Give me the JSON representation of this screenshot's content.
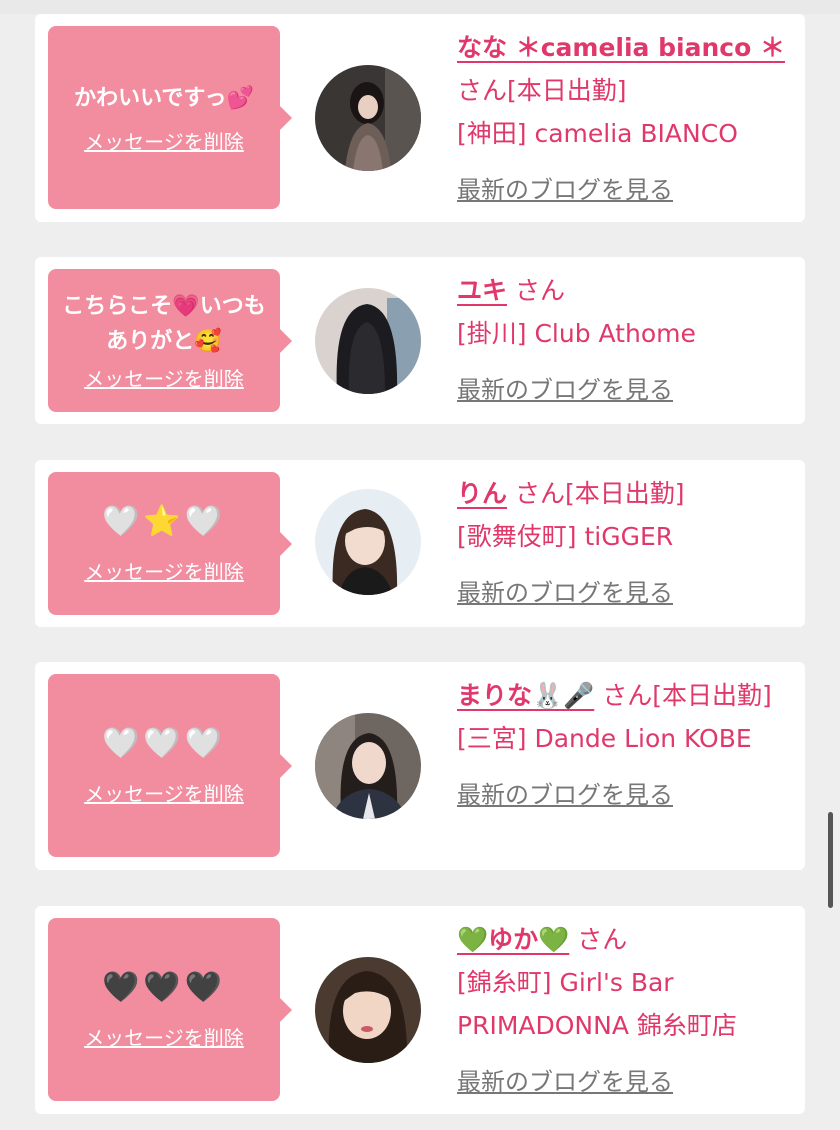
{
  "common": {
    "delete_label": "メッセージを削除",
    "blog_label": "最新のブログを見る"
  },
  "cards": [
    {
      "message": "かわいいですっ💕",
      "name": "なな ＊camelia bianco ＊",
      "status": "さん[本日出勤]",
      "shop": "[神田] camelia BIANCO"
    },
    {
      "message": "こちらこそ💗いつもありがと🥰",
      "name": "ユキ",
      "status": "さん",
      "shop": "[掛川] Club Athome"
    },
    {
      "message": "🤍⭐🤍",
      "name": "りん",
      "status": "さん[本日出勤]",
      "shop": "[歌舞伎町] tiGGER"
    },
    {
      "message": "🤍🤍🤍",
      "name": "まりな🐰🎤",
      "status": "さん[本日出勤]",
      "shop": "[三宮] Dande Lion KOBE"
    },
    {
      "message": "🖤🖤🖤",
      "name": "💚ゆか💚",
      "status": "さん",
      "shop": "[錦糸町] Girl's Bar PRIMADONNA 錦糸町店"
    }
  ],
  "colors": {
    "accent_pink": "#e0386a",
    "bubble_pink": "#f28da0",
    "link_gray": "#777777"
  }
}
